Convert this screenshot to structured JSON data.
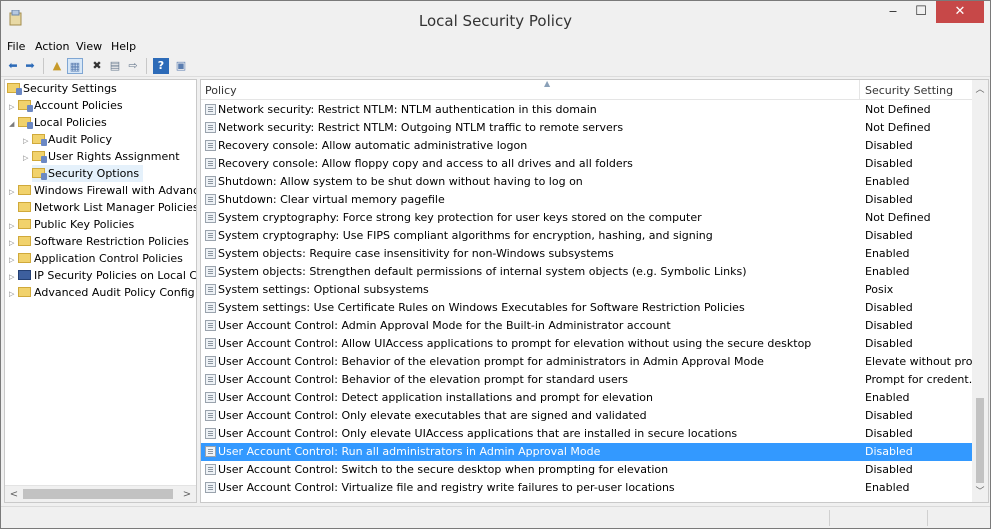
{
  "window": {
    "title": "Local Security Policy"
  },
  "menu": [
    "File",
    "Action",
    "View",
    "Help"
  ],
  "toolbar": {
    "buttons": [
      {
        "name": "back-icon",
        "glyph": "⬅"
      },
      {
        "name": "forward-icon",
        "glyph": "➡"
      },
      {
        "name": "up-folder-icon",
        "glyph": "▲"
      },
      {
        "name": "show-hide-tree-icon",
        "glyph": "▦"
      },
      {
        "name": "delete-icon",
        "glyph": "✖"
      },
      {
        "name": "properties-icon",
        "glyph": "▤"
      },
      {
        "name": "export-list-icon",
        "glyph": "⇨"
      },
      {
        "name": "help-icon",
        "glyph": "?"
      },
      {
        "name": "console-view-icon",
        "glyph": "▣"
      }
    ]
  },
  "tree": {
    "items": [
      {
        "label": "Security Settings",
        "depth": 0,
        "arrow": "",
        "icon": "sec"
      },
      {
        "label": "Account Policies",
        "depth": 1,
        "arrow": "▷",
        "icon": "sec"
      },
      {
        "label": "Local Policies",
        "depth": 1,
        "arrow": "◢",
        "icon": "sec"
      },
      {
        "label": "Audit Policy",
        "depth": 2,
        "arrow": "▷",
        "icon": "sec"
      },
      {
        "label": "User Rights Assignment",
        "depth": 2,
        "arrow": "▷",
        "icon": "sec"
      },
      {
        "label": "Security Options",
        "depth": 2,
        "arrow": "",
        "icon": "sec",
        "selected": true
      },
      {
        "label": "Windows Firewall with Advanc",
        "depth": 1,
        "arrow": "▷",
        "icon": "folder"
      },
      {
        "label": "Network List Manager Policies",
        "depth": 1,
        "arrow": "",
        "icon": "folder"
      },
      {
        "label": "Public Key Policies",
        "depth": 1,
        "arrow": "▷",
        "icon": "folder"
      },
      {
        "label": "Software Restriction Policies",
        "depth": 1,
        "arrow": "▷",
        "icon": "folder"
      },
      {
        "label": "Application Control Policies",
        "depth": 1,
        "arrow": "▷",
        "icon": "folder"
      },
      {
        "label": "IP Security Policies on Local Co",
        "depth": 1,
        "arrow": "▷",
        "icon": "folder"
      },
      {
        "label": "Advanced Audit Policy Config",
        "depth": 1,
        "arrow": "▷",
        "icon": "folder"
      }
    ],
    "scroll_left": "<",
    "scroll_right": ">"
  },
  "list": {
    "columns": {
      "policy": "Policy",
      "setting": "Security Setting"
    },
    "rows": [
      {
        "policy": "Network security: Restrict NTLM: NTLM authentication in this domain",
        "setting": "Not Defined"
      },
      {
        "policy": "Network security: Restrict NTLM: Outgoing NTLM traffic to remote servers",
        "setting": "Not Defined"
      },
      {
        "policy": "Recovery console: Allow automatic administrative logon",
        "setting": "Disabled"
      },
      {
        "policy": "Recovery console: Allow floppy copy and access to all drives and all folders",
        "setting": "Disabled"
      },
      {
        "policy": "Shutdown: Allow system to be shut down without having to log on",
        "setting": "Enabled"
      },
      {
        "policy": "Shutdown: Clear virtual memory pagefile",
        "setting": "Disabled"
      },
      {
        "policy": "System cryptography: Force strong key protection for user keys stored on the computer",
        "setting": "Not Defined"
      },
      {
        "policy": "System cryptography: Use FIPS compliant algorithms for encryption, hashing, and signing",
        "setting": "Disabled"
      },
      {
        "policy": "System objects: Require case insensitivity for non-Windows subsystems",
        "setting": "Enabled"
      },
      {
        "policy": "System objects: Strengthen default permissions of internal system objects (e.g. Symbolic Links)",
        "setting": "Enabled"
      },
      {
        "policy": "System settings: Optional subsystems",
        "setting": "Posix"
      },
      {
        "policy": "System settings: Use Certificate Rules on Windows Executables for Software Restriction Policies",
        "setting": "Disabled"
      },
      {
        "policy": "User Account Control: Admin Approval Mode for the Built-in Administrator account",
        "setting": "Disabled"
      },
      {
        "policy": "User Account Control: Allow UIAccess applications to prompt for elevation without using the secure desktop",
        "setting": "Disabled"
      },
      {
        "policy": "User Account Control: Behavior of the elevation prompt for administrators in Admin Approval Mode",
        "setting": "Elevate without pro..."
      },
      {
        "policy": "User Account Control: Behavior of the elevation prompt for standard users",
        "setting": "Prompt for credent..."
      },
      {
        "policy": "User Account Control: Detect application installations and prompt for elevation",
        "setting": "Enabled"
      },
      {
        "policy": "User Account Control: Only elevate executables that are signed and validated",
        "setting": "Disabled"
      },
      {
        "policy": "User Account Control: Only elevate UIAccess applications that are installed in secure locations",
        "setting": "Disabled"
      },
      {
        "policy": "User Account Control: Run all administrators in Admin Approval Mode",
        "setting": "Disabled",
        "selected": true
      },
      {
        "policy": "User Account Control: Switch to the secure desktop when prompting for elevation",
        "setting": "Disabled"
      },
      {
        "policy": "User Account Control: Virtualize file and registry write failures to per-user locations",
        "setting": "Enabled"
      }
    ]
  },
  "colors": {
    "selection": "#3399ff",
    "close_button": "#c74848",
    "tree_selection": "#e5f1fb"
  }
}
